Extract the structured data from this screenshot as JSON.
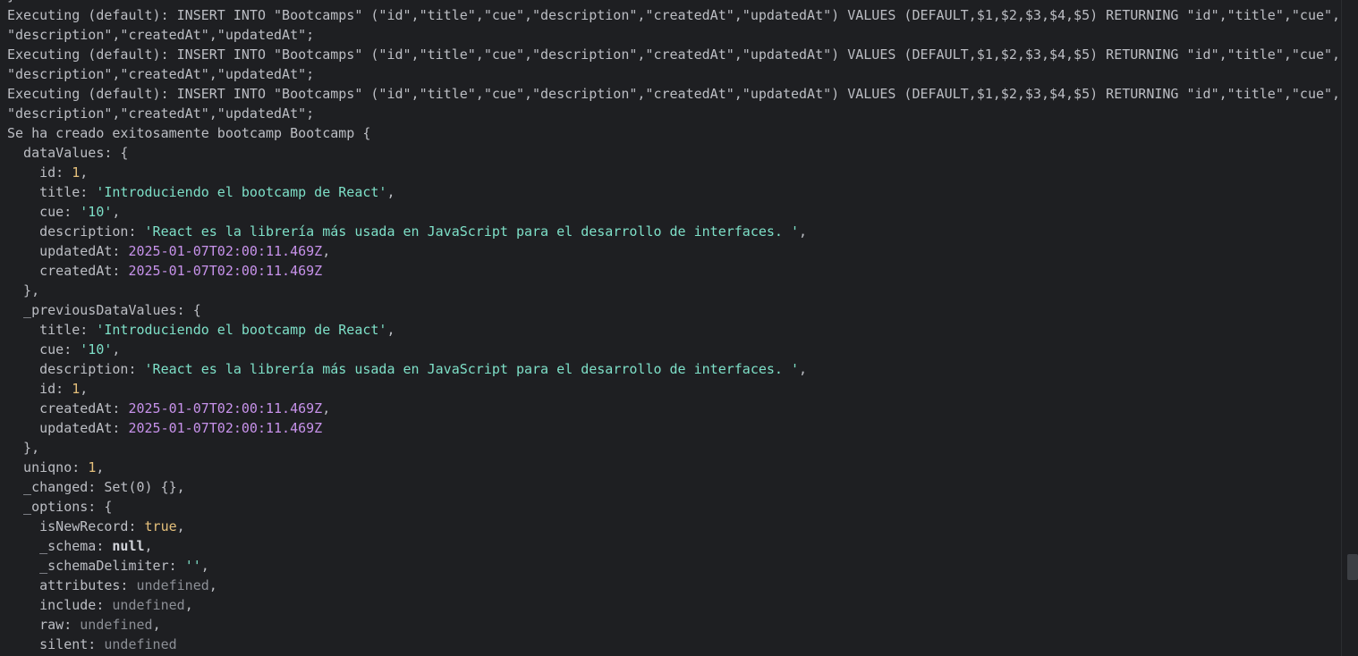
{
  "terminal": {
    "colors": {
      "background": "#1e1f22",
      "text": "#bcbec4",
      "number": "#e5c07b",
      "string": "#7ee0c8",
      "date": "#c792ea",
      "keyword": "#e5c07b",
      "null": "#d4d6dc",
      "undefined": "#8c8f96"
    },
    "lines": [
      [
        {
          "t": "}",
          "k": "plain"
        }
      ],
      [
        {
          "t": "Executing (default): INSERT INTO \"Bootcamps\" (\"id\",\"title\",\"cue\",\"description\",\"createdAt\",\"updatedAt\") VALUES (DEFAULT,$1,$2,$3,$4,$5) RETURNING \"id\",\"title\",\"cue\",",
          "k": "plain"
        }
      ],
      [
        {
          "t": "\"description\",\"createdAt\",\"updatedAt\";",
          "k": "plain"
        }
      ],
      [
        {
          "t": "Executing (default): INSERT INTO \"Bootcamps\" (\"id\",\"title\",\"cue\",\"description\",\"createdAt\",\"updatedAt\") VALUES (DEFAULT,$1,$2,$3,$4,$5) RETURNING \"id\",\"title\",\"cue\",",
          "k": "plain"
        }
      ],
      [
        {
          "t": "\"description\",\"createdAt\",\"updatedAt\";",
          "k": "plain"
        }
      ],
      [
        {
          "t": "Executing (default): INSERT INTO \"Bootcamps\" (\"id\",\"title\",\"cue\",\"description\",\"createdAt\",\"updatedAt\") VALUES (DEFAULT,$1,$2,$3,$4,$5) RETURNING \"id\",\"title\",\"cue\",",
          "k": "plain"
        }
      ],
      [
        {
          "t": "\"description\",\"createdAt\",\"updatedAt\";",
          "k": "plain"
        }
      ],
      [
        {
          "t": "Se ha creado exitosamente bootcamp Bootcamp {",
          "k": "plain"
        }
      ],
      [
        {
          "t": "  dataValues: {",
          "k": "plain"
        }
      ],
      [
        {
          "t": "    id: ",
          "k": "plain"
        },
        {
          "t": "1",
          "k": "num"
        },
        {
          "t": ",",
          "k": "plain"
        }
      ],
      [
        {
          "t": "    title: ",
          "k": "plain"
        },
        {
          "t": "'Introduciendo el bootcamp de React'",
          "k": "str"
        },
        {
          "t": ",",
          "k": "plain"
        }
      ],
      [
        {
          "t": "    cue: ",
          "k": "plain"
        },
        {
          "t": "'10'",
          "k": "str"
        },
        {
          "t": ",",
          "k": "plain"
        }
      ],
      [
        {
          "t": "    description: ",
          "k": "plain"
        },
        {
          "t": "'React es la librería más usada en JavaScript para el desarrollo de interfaces. '",
          "k": "str"
        },
        {
          "t": ",",
          "k": "plain"
        }
      ],
      [
        {
          "t": "    updatedAt: ",
          "k": "plain"
        },
        {
          "t": "2025-01-07T02:00:11.469Z",
          "k": "date"
        },
        {
          "t": ",",
          "k": "plain"
        }
      ],
      [
        {
          "t": "    createdAt: ",
          "k": "plain"
        },
        {
          "t": "2025-01-07T02:00:11.469Z",
          "k": "date"
        }
      ],
      [
        {
          "t": "  },",
          "k": "plain"
        }
      ],
      [
        {
          "t": "  _previousDataValues: {",
          "k": "plain"
        }
      ],
      [
        {
          "t": "    title: ",
          "k": "plain"
        },
        {
          "t": "'Introduciendo el bootcamp de React'",
          "k": "str"
        },
        {
          "t": ",",
          "k": "plain"
        }
      ],
      [
        {
          "t": "    cue: ",
          "k": "plain"
        },
        {
          "t": "'10'",
          "k": "str"
        },
        {
          "t": ",",
          "k": "plain"
        }
      ],
      [
        {
          "t": "    description: ",
          "k": "plain"
        },
        {
          "t": "'React es la librería más usada en JavaScript para el desarrollo de interfaces. '",
          "k": "str"
        },
        {
          "t": ",",
          "k": "plain"
        }
      ],
      [
        {
          "t": "    id: ",
          "k": "plain"
        },
        {
          "t": "1",
          "k": "num"
        },
        {
          "t": ",",
          "k": "plain"
        }
      ],
      [
        {
          "t": "    createdAt: ",
          "k": "plain"
        },
        {
          "t": "2025-01-07T02:00:11.469Z",
          "k": "date"
        },
        {
          "t": ",",
          "k": "plain"
        }
      ],
      [
        {
          "t": "    updatedAt: ",
          "k": "plain"
        },
        {
          "t": "2025-01-07T02:00:11.469Z",
          "k": "date"
        }
      ],
      [
        {
          "t": "  },",
          "k": "plain"
        }
      ],
      [
        {
          "t": "  uniqno: ",
          "k": "plain"
        },
        {
          "t": "1",
          "k": "num"
        },
        {
          "t": ",",
          "k": "plain"
        }
      ],
      [
        {
          "t": "  _changed: Set(0) {},",
          "k": "plain"
        }
      ],
      [
        {
          "t": "  _options: {",
          "k": "plain"
        }
      ],
      [
        {
          "t": "    isNewRecord: ",
          "k": "plain"
        },
        {
          "t": "true",
          "k": "bool"
        },
        {
          "t": ",",
          "k": "plain"
        }
      ],
      [
        {
          "t": "    _schema: ",
          "k": "plain"
        },
        {
          "t": "null",
          "k": "null"
        },
        {
          "t": ",",
          "k": "plain"
        }
      ],
      [
        {
          "t": "    _schemaDelimiter: ",
          "k": "plain"
        },
        {
          "t": "''",
          "k": "str"
        },
        {
          "t": ",",
          "k": "plain"
        }
      ],
      [
        {
          "t": "    attributes: ",
          "k": "plain"
        },
        {
          "t": "undefined",
          "k": "undef"
        },
        {
          "t": ",",
          "k": "plain"
        }
      ],
      [
        {
          "t": "    include: ",
          "k": "plain"
        },
        {
          "t": "undefined",
          "k": "undef"
        },
        {
          "t": ",",
          "k": "plain"
        }
      ],
      [
        {
          "t": "    raw: ",
          "k": "plain"
        },
        {
          "t": "undefined",
          "k": "undef"
        },
        {
          "t": ",",
          "k": "plain"
        }
      ],
      [
        {
          "t": "    silent: ",
          "k": "plain"
        },
        {
          "t": "undefined",
          "k": "undef"
        }
      ]
    ]
  },
  "scrollbar": {
    "position_fraction": 0.88,
    "visible_fraction": 0.04
  }
}
